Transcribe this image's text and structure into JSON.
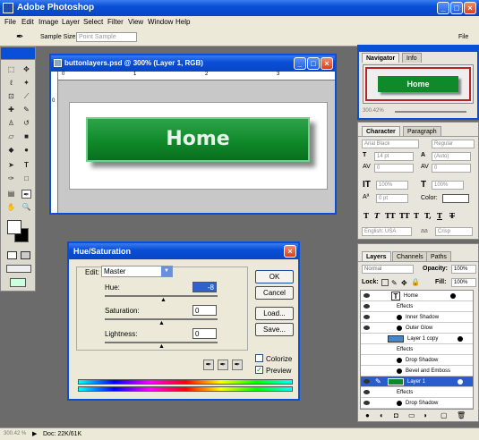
{
  "app": {
    "title": "Adobe Photoshop",
    "menu": [
      "File",
      "Edit",
      "Image",
      "Layer",
      "Select",
      "Filter",
      "View",
      "Window",
      "Help"
    ]
  },
  "options": {
    "sample_size_label": "Sample Size:",
    "sample_size_value": "Point Sample",
    "file_tab": "File"
  },
  "doc": {
    "title": "buttonlayers.psd @ 300% (Layer 1, RGB)",
    "button_text": "Home",
    "ruler_marks": [
      "0",
      "1",
      "2",
      "3"
    ],
    "zero": "0"
  },
  "navigator": {
    "tabs": [
      "Navigator",
      "Info"
    ],
    "thumb_text": "Home",
    "zoom": "300.42%"
  },
  "character": {
    "tabs": [
      "Character",
      "Paragraph"
    ],
    "font": "Arial Black",
    "style": "Regular",
    "size": "14 pt",
    "leading": "(Auto)",
    "kerning": "0",
    "tracking": "0",
    "vscale": "100%",
    "hscale": "100%",
    "baseline": "0 pt",
    "color_label": "Color:",
    "language": "English: USA",
    "aa": "aa",
    "aa_value": "Crisp",
    "styles": [
      "T",
      "T",
      "TT",
      "TT",
      "T",
      "T,",
      "T",
      "T",
      "T"
    ]
  },
  "layers": {
    "tabs": [
      "Layers",
      "Channels",
      "Paths"
    ],
    "mode": "Normal",
    "opacity_label": "Opacity:",
    "opacity": "100%",
    "lock_label": "Lock:",
    "fill_label": "Fill:",
    "fill": "100%",
    "rows": [
      "Home",
      "Effects",
      "Inner Shadow",
      "Outer Glow",
      "Layer 1 copy",
      "Effects",
      "Drop Shadow",
      "Bevel and Emboss",
      "Layer 1",
      "Effects",
      "Drop Shadow"
    ]
  },
  "hue": {
    "title": "Hue/Saturation",
    "edit_label": "Edit:",
    "edit_value": "Master",
    "hue_label": "Hue:",
    "hue_value": "-8",
    "sat_label": "Saturation:",
    "sat_value": "0",
    "light_label": "Lightness:",
    "light_value": "0",
    "ok": "OK",
    "cancel": "Cancel",
    "load": "Load...",
    "save": "Save...",
    "colorize": "Colorize",
    "preview": "Preview"
  },
  "status": {
    "zoom": "300.42 %",
    "doc": "Doc: 22K/61K"
  },
  "colors": {
    "accent": "#0a4fd8",
    "button_green": "#0f8a2a"
  }
}
